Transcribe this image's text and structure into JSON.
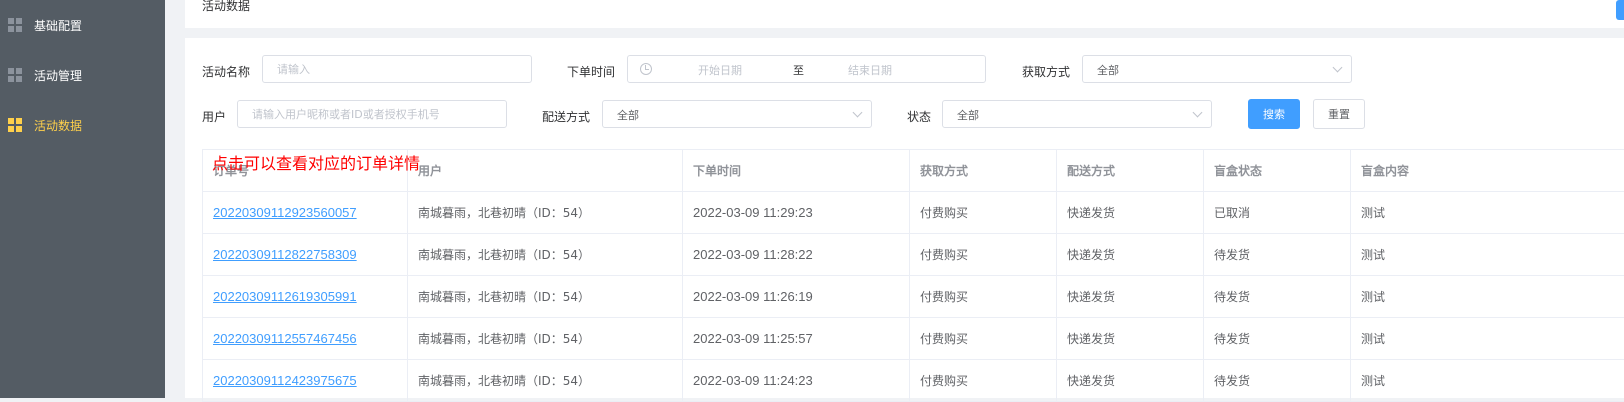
{
  "sidebar": {
    "items": [
      {
        "label": "基础配置",
        "icon": "grid-icon",
        "active": false
      },
      {
        "label": "活动管理",
        "icon": "grid-icon",
        "active": false
      },
      {
        "label": "活动数据",
        "icon": "grid-icon",
        "active": true
      }
    ]
  },
  "header": {
    "title": "活动数据"
  },
  "filters": {
    "activity_name": {
      "label": "活动名称",
      "placeholder": "请输入"
    },
    "order_time": {
      "label": "下单时间",
      "start_placeholder": "开始日期",
      "separator": "至",
      "end_placeholder": "结束日期"
    },
    "acquire_method": {
      "label": "获取方式",
      "value": "全部"
    },
    "user": {
      "label": "用户",
      "placeholder": "请输入用户昵称或者ID或者授权手机号"
    },
    "delivery_method": {
      "label": "配送方式",
      "value": "全部"
    },
    "status": {
      "label": "状态",
      "value": "全部"
    },
    "search_label": "搜索",
    "reset_label": "重置"
  },
  "annotation": "点击可以查看对应的订单详情",
  "table": {
    "columns": [
      "订单号",
      "用户",
      "下单时间",
      "获取方式",
      "配送方式",
      "盲盒状态",
      "盲盒内容"
    ],
    "rows": [
      [
        "20220309112923560057",
        "南城暮雨，北巷初晴（ID：54）",
        "2022-03-09 11:29:23",
        "付费购买",
        "快递发货",
        "已取消",
        "测试"
      ],
      [
        "20220309112822758309",
        "南城暮雨，北巷初晴（ID：54）",
        "2022-03-09 11:28:22",
        "付费购买",
        "快递发货",
        "待发货",
        "测试"
      ],
      [
        "20220309112619305991",
        "南城暮雨，北巷初晴（ID：54）",
        "2022-03-09 11:26:19",
        "付费购买",
        "快递发货",
        "待发货",
        "测试"
      ],
      [
        "20220309112557467456",
        "南城暮雨，北巷初晴（ID：54）",
        "2022-03-09 11:25:57",
        "付费购买",
        "快递发货",
        "待发货",
        "测试"
      ],
      [
        "20220309112423975675",
        "南城暮雨，北巷初晴（ID：54）",
        "2022-03-09 11:24:23",
        "付费购买",
        "快递发货",
        "待发货",
        "测试"
      ]
    ]
  },
  "colors": {
    "accent": "#409eff",
    "sidebar_bg": "#545c64",
    "sidebar_active": "#ffd04b",
    "annotation": "#ff0000"
  }
}
